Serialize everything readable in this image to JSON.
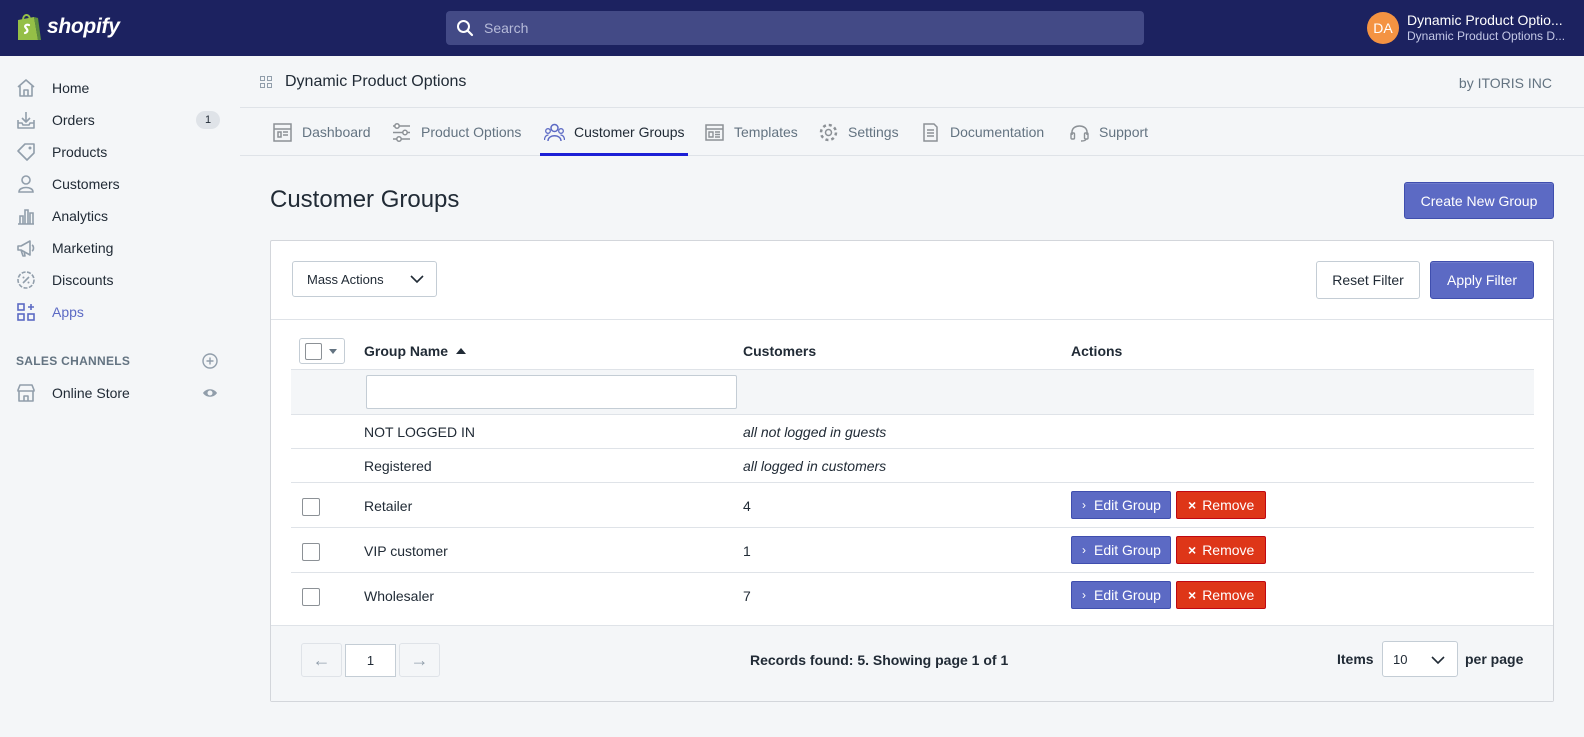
{
  "topbar": {
    "brand": "shopify",
    "search_placeholder": "Search",
    "account": {
      "initials": "DA",
      "name": "Dynamic Product Optio...",
      "store": "Dynamic Product Options D..."
    }
  },
  "sidebar": {
    "items": [
      {
        "label": "Home",
        "icon": "home-icon"
      },
      {
        "label": "Orders",
        "icon": "orders-icon",
        "badge": "1"
      },
      {
        "label": "Products",
        "icon": "tag-icon"
      },
      {
        "label": "Customers",
        "icon": "person-icon"
      },
      {
        "label": "Analytics",
        "icon": "bar-chart-icon"
      },
      {
        "label": "Marketing",
        "icon": "megaphone-icon"
      },
      {
        "label": "Discounts",
        "icon": "discount-icon"
      },
      {
        "label": "Apps",
        "icon": "apps-icon"
      }
    ],
    "sales_channels_title": "SALES CHANNELS",
    "channels": [
      {
        "label": "Online Store",
        "icon": "store-icon"
      }
    ]
  },
  "app": {
    "title": "Dynamic Product Options",
    "vendor": "by ITORIS INC"
  },
  "tabs": [
    {
      "label": "Dashboard",
      "icon": "dashboard-icon"
    },
    {
      "label": "Product Options",
      "icon": "sliders-icon"
    },
    {
      "label": "Customer Groups",
      "icon": "users-icon",
      "active": true
    },
    {
      "label": "Templates",
      "icon": "templates-icon"
    },
    {
      "label": "Settings",
      "icon": "gear-icon"
    },
    {
      "label": "Documentation",
      "icon": "document-icon"
    },
    {
      "label": "Support",
      "icon": "headset-icon"
    }
  ],
  "page": {
    "title": "Customer Groups",
    "create_button": "Create New Group",
    "mass_actions": "Mass Actions",
    "reset_filter": "Reset Filter",
    "apply_filter": "Apply Filter"
  },
  "grid": {
    "columns": [
      "Group Name",
      "Customers",
      "Actions"
    ],
    "filter_value": "",
    "rows": [
      {
        "name": "NOT LOGGED IN",
        "customers": "all not logged in guests",
        "selectable": false
      },
      {
        "name": "Registered",
        "customers": "all logged in customers",
        "selectable": false
      },
      {
        "name": "Retailer",
        "customers": "4",
        "selectable": true
      },
      {
        "name": "VIP customer",
        "customers": "1",
        "selectable": true
      },
      {
        "name": "Wholesaler",
        "customers": "7",
        "selectable": true
      }
    ],
    "edit_label": "Edit Group",
    "remove_label": "Remove"
  },
  "pagination": {
    "page": "1",
    "records_text": "Records found: 5. Showing page 1 of 1",
    "items_label": "Items",
    "per_page_value": "10",
    "per_page_label": "per page"
  },
  "colors": {
    "topbar": "#1c2260",
    "primary": "#5c6ac4",
    "danger": "#de3618",
    "tab_underline": "#1c1fd6"
  }
}
